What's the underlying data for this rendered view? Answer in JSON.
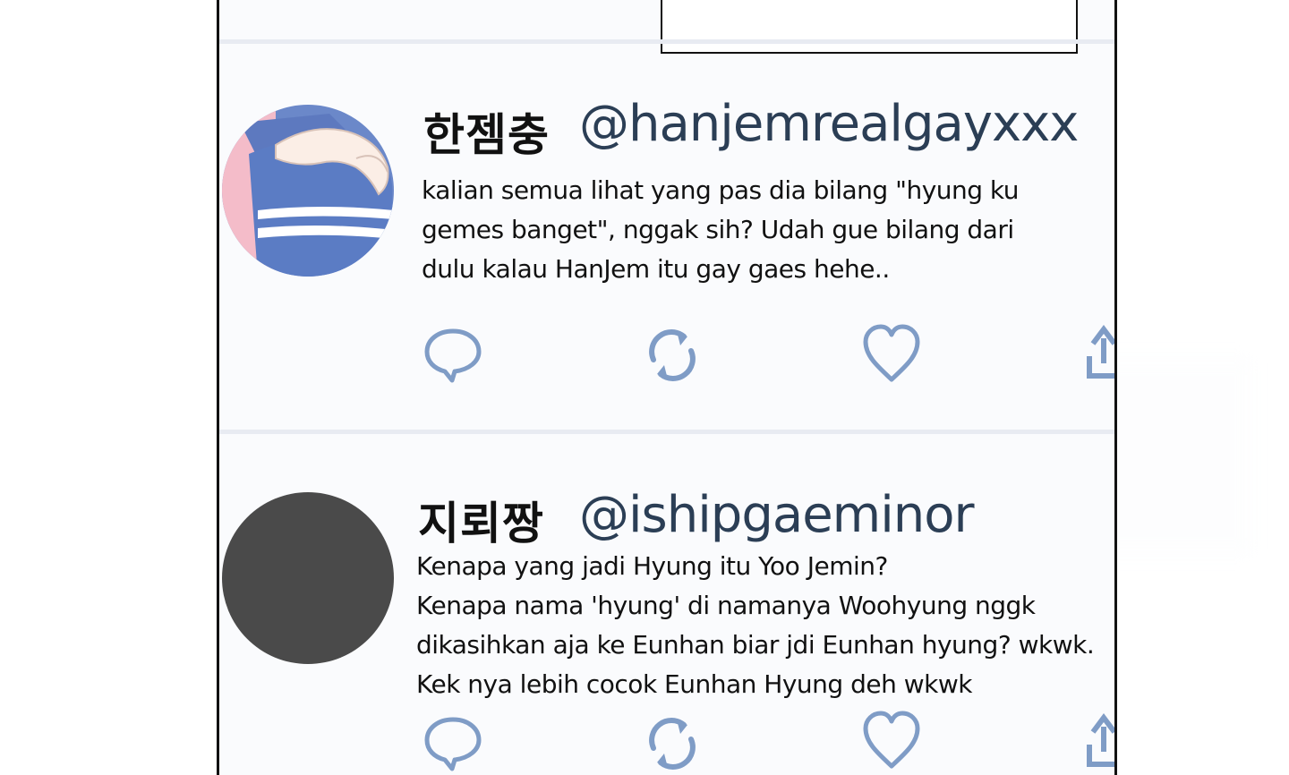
{
  "posts": [
    {
      "display_name": "한젬충",
      "handle": "@hanjemrealgayxxx",
      "lines": [
        "kalian semua lihat yang pas dia bilang \"hyung ku",
        "gemes banget\", nggak sih? Udah gue bilang dari",
        "dulu kalau HanJem itu gay gaes hehe.."
      ]
    },
    {
      "display_name": "지뢰짱",
      "handle": "@ishipgaeminor",
      "lines": [
        "Kenapa yang jadi Hyung itu Yoo Jemin?",
        "Kenapa nama 'hyung' di namanya Woohyung nggk",
        "dikasihkan aja ke Eunhan biar jdi Eunhan hyung? wkwk.",
        "Kek nya lebih cocok Eunhan Hyung deh wkwk"
      ]
    }
  ],
  "icons": {
    "reply": "speech-bubble-icon",
    "retweet": "retweet-icon",
    "like": "heart-icon",
    "share": "share-icon"
  },
  "colors": {
    "icon": "#7f9cc6",
    "handle": "#2b3e55",
    "divider": "#e8ebf2",
    "avatar_dark": "#4a4a4a"
  }
}
